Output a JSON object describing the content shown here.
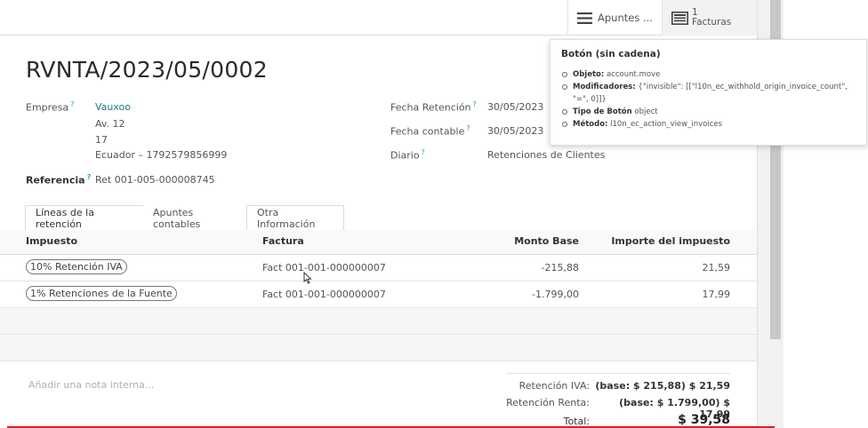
{
  "smart_buttons": {
    "apuntes": {
      "label": "Apuntes ...",
      "icon": "list-icon"
    },
    "facturas": {
      "count": "1",
      "label": "Facturas",
      "icon": "invoice-icon"
    }
  },
  "record": {
    "title": "RVNTA/2023/05/0002",
    "empresa_label": "Empresa",
    "empresa_value": "Vauxoo",
    "address_line1": "Av. 12",
    "address_line2": "17",
    "address_line3": "Ecuador – 1792579856999",
    "referencia_label": "Referencia",
    "referencia_value": "Ret 001-005-000008745",
    "fecha_retencion_label": "Fecha Retención",
    "fecha_retencion_value": "30/05/2023",
    "fecha_contable_label": "Fecha contable",
    "fecha_contable_value": "30/05/2023",
    "diario_label": "Diario",
    "diario_value": "Retenciones de Clientes"
  },
  "tabs": [
    {
      "label": "Líneas de la retención",
      "active": true
    },
    {
      "label": "Apuntes contables",
      "active": false
    },
    {
      "label": "Otra Información",
      "active": false
    }
  ],
  "table": {
    "headers": [
      "Impuesto",
      "Factura",
      "Monto Base",
      "Importe del impuesto"
    ],
    "rows": [
      {
        "impuesto": "10% Retención IVA",
        "factura": "Fact 001-001-000000007",
        "monto_base": "-215,88",
        "importe": "21,59"
      },
      {
        "impuesto": "1% Retenciones de la Fuente",
        "factura": "Fact 001-001-000000007",
        "monto_base": "-1.799,00",
        "importe": "17,99"
      }
    ]
  },
  "note_placeholder": "Añadir una nota interna...",
  "totals": {
    "iva_label": "Retención IVA:",
    "iva_value": "(base: $ 215,88) $ 21,59",
    "renta_label": "Retención Renta:",
    "renta_value": "(base: $ 1.799,00) $ 17,99",
    "total_label": "Total:",
    "total_value": "$ 39,58"
  },
  "tooltip": {
    "title": "Botón (sin cadena)",
    "objeto_label": "Objeto:",
    "objeto_value": "account.move",
    "modificadores_label": "Modificadores:",
    "modificadores_value": "{\"invisible\": [[\"l10n_ec_withhold_origin_invoice_count\",",
    "modificadores_value2": "\"=\", 0]]}",
    "tipo_label": "Tipo de Botón",
    "tipo_value": "object",
    "metodo_label": "Método:",
    "metodo_value": "l10n_ec_action_view_invoices"
  },
  "colors": {
    "link": "#1f7a8c",
    "help_mark": "#2aa7a1",
    "recording_line": "#d32222"
  }
}
